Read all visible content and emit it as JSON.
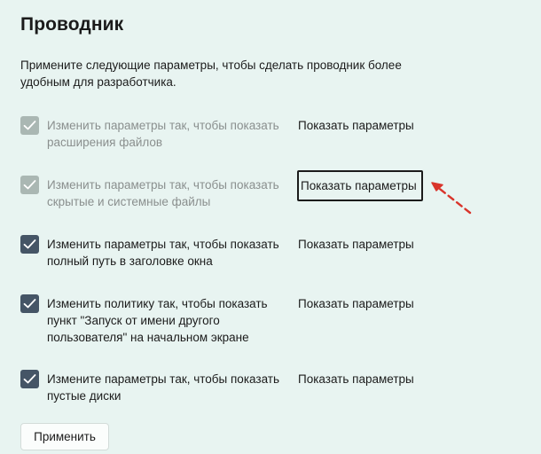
{
  "page": {
    "title": "Проводник",
    "description": "Примените следующие параметры, чтобы сделать проводник более удобным для разработчика."
  },
  "settings": [
    {
      "label": "Изменить параметры так, чтобы показать расширения файлов",
      "checked": true,
      "disabled": true,
      "link": "Показать параметры"
    },
    {
      "label": "Изменить параметры так, чтобы показать скрытые и системные файлы",
      "checked": true,
      "disabled": true,
      "link": "Показать параметры",
      "focused": true
    },
    {
      "label": "Изменить параметры так, чтобы показать полный путь в заголовке окна",
      "checked": true,
      "disabled": false,
      "link": "Показать параметры"
    },
    {
      "label": "Изменить политику так, чтобы показать пункт \"Запуск от имени другого пользователя\" на начальном экране",
      "checked": true,
      "disabled": false,
      "link": "Показать параметры"
    },
    {
      "label": "Измените параметры так, чтобы показать пустые диски",
      "checked": true,
      "disabled": false,
      "link": "Показать параметры"
    }
  ],
  "apply_button": {
    "label": "Применить"
  },
  "colors": {
    "background": "#e8f4f1",
    "checkbox_enabled": "#455566",
    "checkbox_disabled": "#aab7b3",
    "annotation_arrow": "#d9342b"
  },
  "icons": {
    "check": "checkmark-icon",
    "annotation": "dashed-arrow-icon"
  }
}
